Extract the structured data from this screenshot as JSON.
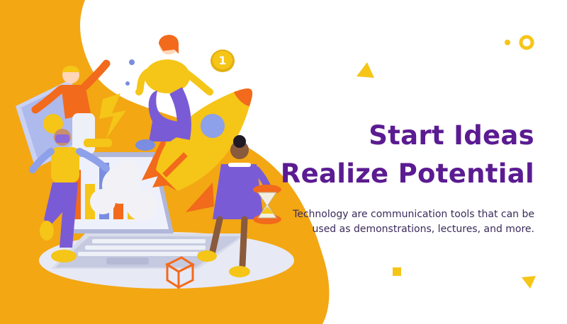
{
  "headline": {
    "line1": "Start Ideas",
    "line2": "Realize Potential"
  },
  "description": {
    "line1": "Technology are communication tools that can be",
    "line2": "used as demonstrations, lectures, and more."
  },
  "colors": {
    "background": "#ffffff",
    "blob_orange": "#f3a713",
    "title_purple": "#5b1b91",
    "accent_yellow": "#f5c518",
    "accent_orange": "#f26a1b",
    "accent_violet": "#7a5bd6"
  },
  "illustration": {
    "subject": "3d-team-launching-rocket-from-laptop",
    "coin_label": "1"
  }
}
